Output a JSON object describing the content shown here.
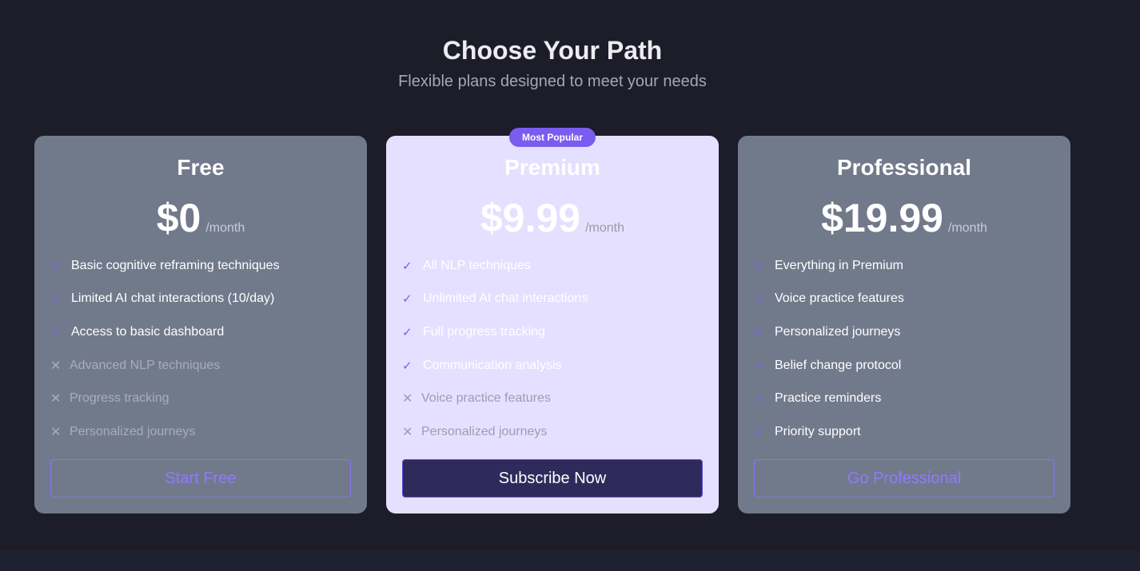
{
  "header": {
    "title": "Choose Your Path",
    "subtitle": "Flexible plans designed to meet your needs"
  },
  "colors": {
    "background": "#1d1d29",
    "card": "#717a8b",
    "featured_card": "#e5e0ff",
    "accent": "#7b5cf0",
    "primary_button": "#2e2b5c"
  },
  "icons": {
    "included": "check-icon",
    "excluded": "x-icon"
  },
  "plans": [
    {
      "name": "Free",
      "price": "$0",
      "period": "/month",
      "features": [
        {
          "text": "Basic cognitive reframing techniques",
          "included": true
        },
        {
          "text": "Limited AI chat interactions (10/day)",
          "included": true
        },
        {
          "text": "Access to basic dashboard",
          "included": true
        },
        {
          "text": "Advanced NLP techniques",
          "included": false
        },
        {
          "text": "Progress tracking",
          "included": false
        },
        {
          "text": "Personalized journeys",
          "included": false
        }
      ],
      "cta": "Start Free"
    },
    {
      "name": "Premium",
      "badge": "Most Popular",
      "price": "$9.99",
      "period": "/month",
      "features": [
        {
          "text": "All NLP techniques",
          "included": true
        },
        {
          "text": "Unlimited AI chat interactions",
          "included": true
        },
        {
          "text": "Full progress tracking",
          "included": true
        },
        {
          "text": "Communication analysis",
          "included": true
        },
        {
          "text": "Voice practice features",
          "included": false
        },
        {
          "text": "Personalized journeys",
          "included": false
        }
      ],
      "cta": "Subscribe Now"
    },
    {
      "name": "Professional",
      "price": "$19.99",
      "period": "/month",
      "features": [
        {
          "text": "Everything in Premium",
          "included": true
        },
        {
          "text": "Voice practice features",
          "included": true
        },
        {
          "text": "Personalized journeys",
          "included": true
        },
        {
          "text": "Belief change protocol",
          "included": true
        },
        {
          "text": "Practice reminders",
          "included": true
        },
        {
          "text": "Priority support",
          "included": true
        }
      ],
      "cta": "Go Professional"
    }
  ]
}
